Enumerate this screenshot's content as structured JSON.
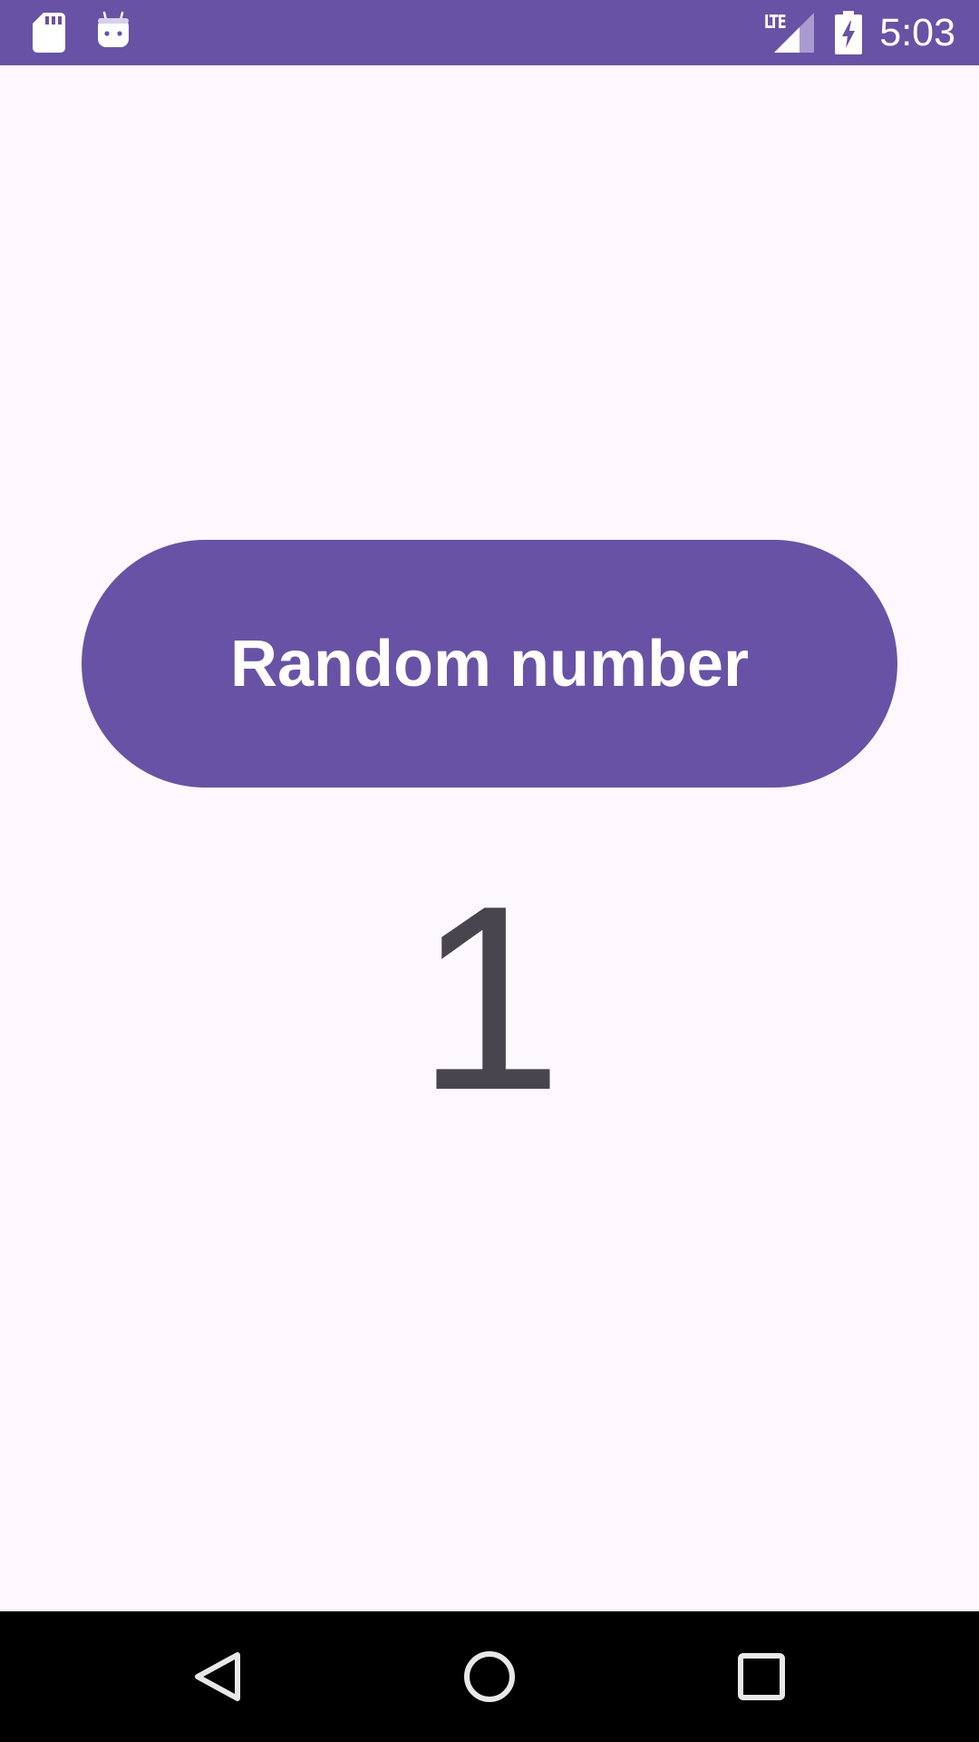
{
  "status_bar": {
    "time": "5:03",
    "network_label": "LTE",
    "background_color": "#6852A5",
    "icons": [
      "sd-card-icon",
      "android-debug-icon",
      "signal-icon",
      "battery-charging-icon"
    ]
  },
  "main": {
    "button_label": "Random number",
    "button_color": "#6852A5",
    "result_value": "1"
  },
  "nav_bar": {
    "icons": [
      "back-icon",
      "home-icon",
      "recents-icon"
    ]
  }
}
